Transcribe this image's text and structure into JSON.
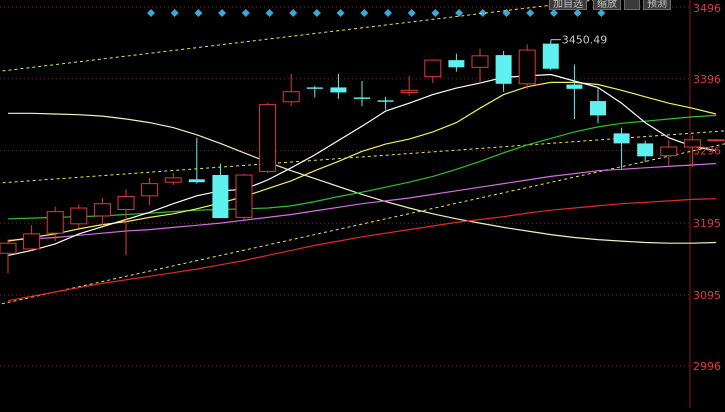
{
  "toolbar": {
    "add_self_select": "加自选",
    "shrink": "缩放",
    "square_icon": "square-icon",
    "preview": "预测"
  },
  "colors": {
    "background": "#000000",
    "up_candle": "#e23a3a",
    "down_candle": "#5ff0f0",
    "ma_white": "#ffffff",
    "ma_yellow": "#f0f060",
    "ma_green": "#30c030",
    "ma_purple": "#d070e0",
    "ma_red": "#e02a2a",
    "ma_long": "#f0f0c0",
    "trend": "#e8e850",
    "grid": "#8a1a1a",
    "marker": "#3aa8d8"
  },
  "chart_data": {
    "type": "candlestick",
    "y_axis_ticks": [
      "3496",
      "3396",
      "3296",
      "3195",
      "3095",
      "2996"
    ],
    "y_tick_values": [
      3496,
      3396,
      3296,
      3195,
      3095,
      2996
    ],
    "ylim": [
      2980,
      3500
    ],
    "high_annotation": "3450.49",
    "high_value": 3450.49,
    "marker_count": 20,
    "candles": [
      {
        "o": 3153,
        "h": 3172,
        "l": 3125,
        "c": 3167
      },
      {
        "o": 3159,
        "h": 3192,
        "l": 3157,
        "c": 3180
      },
      {
        "o": 3181,
        "h": 3218,
        "l": 3170,
        "c": 3211
      },
      {
        "o": 3194,
        "h": 3221,
        "l": 3188,
        "c": 3216
      },
      {
        "o": 3205,
        "h": 3230,
        "l": 3192,
        "c": 3222
      },
      {
        "o": 3214,
        "h": 3242,
        "l": 3150,
        "c": 3232
      },
      {
        "o": 3233,
        "h": 3258,
        "l": 3220,
        "c": 3250
      },
      {
        "o": 3252,
        "h": 3265,
        "l": 3248,
        "c": 3258
      },
      {
        "o": 3256,
        "h": 3314,
        "l": 3250,
        "c": 3252
      },
      {
        "o": 3262,
        "h": 3278,
        "l": 3205,
        "c": 3202
      },
      {
        "o": 3203,
        "h": 3264,
        "l": 3200,
        "c": 3262
      },
      {
        "o": 3267,
        "h": 3362,
        "l": 3265,
        "c": 3360
      },
      {
        "o": 3364,
        "h": 3403,
        "l": 3358,
        "c": 3378
      },
      {
        "o": 3384,
        "h": 3386,
        "l": 3370,
        "c": 3382
      },
      {
        "o": 3384,
        "h": 3403,
        "l": 3368,
        "c": 3377
      },
      {
        "o": 3370,
        "h": 3393,
        "l": 3358,
        "c": 3368
      },
      {
        "o": 3366,
        "h": 3371,
        "l": 3353,
        "c": 3364
      },
      {
        "o": 3377,
        "h": 3400,
        "l": 3372,
        "c": 3380
      },
      {
        "o": 3399,
        "h": 3423,
        "l": 3390,
        "c": 3422
      },
      {
        "o": 3422,
        "h": 3431,
        "l": 3406,
        "c": 3412
      },
      {
        "o": 3412,
        "h": 3438,
        "l": 3390,
        "c": 3428
      },
      {
        "o": 3429,
        "h": 3435,
        "l": 3378,
        "c": 3389
      },
      {
        "o": 3389,
        "h": 3444,
        "l": 3382,
        "c": 3436
      },
      {
        "o": 3445,
        "h": 3450.49,
        "l": 3408,
        "c": 3410
      },
      {
        "o": 3388,
        "h": 3416,
        "l": 3340,
        "c": 3382
      },
      {
        "o": 3365,
        "h": 3384,
        "l": 3334,
        "c": 3345
      },
      {
        "o": 3320,
        "h": 3328,
        "l": 3271,
        "c": 3306
      },
      {
        "o": 3306,
        "h": 3310,
        "l": 3280,
        "c": 3288
      },
      {
        "o": 3289,
        "h": 3311,
        "l": 3274,
        "c": 3301
      },
      {
        "o": 3301,
        "h": 3317,
        "l": 3273,
        "c": 3311
      },
      {
        "o": 3311,
        "h": 3312,
        "l": 3310,
        "c": 3311
      }
    ],
    "ma_white": [
      3150,
      3157,
      3166,
      3180,
      3190,
      3200,
      3210,
      3222,
      3233,
      3240,
      3242,
      3255,
      3272,
      3290,
      3310,
      3330,
      3351,
      3362,
      3374,
      3383,
      3390,
      3398,
      3400,
      3402,
      3393,
      3384,
      3362,
      3335,
      3314,
      3302,
      3296
    ],
    "ma_yellow": [
      3170,
      3175,
      3180,
      3187,
      3193,
      3197,
      3203,
      3208,
      3215,
      3223,
      3232,
      3243,
      3254,
      3268,
      3281,
      3295,
      3305,
      3312,
      3322,
      3335,
      3355,
      3374,
      3385,
      3391,
      3391,
      3388,
      3380,
      3371,
      3362,
      3355,
      3347
    ],
    "ma_green": [
      3201,
      3202,
      3203,
      3204,
      3205,
      3207,
      3209,
      3211,
      3213,
      3214,
      3215,
      3216,
      3219,
      3225,
      3232,
      3238,
      3245,
      3252,
      3260,
      3270,
      3281,
      3293,
      3304,
      3313,
      3322,
      3329,
      3334,
      3337,
      3340,
      3343,
      3345
    ],
    "ma_purple": [
      3171,
      3173,
      3175,
      3178,
      3181,
      3184,
      3186,
      3189,
      3192,
      3195,
      3199,
      3203,
      3207,
      3212,
      3217,
      3222,
      3226,
      3230,
      3235,
      3240,
      3245,
      3250,
      3255,
      3260,
      3264,
      3268,
      3270,
      3272,
      3274,
      3276,
      3278
    ],
    "ma_red": [
      3087,
      3093,
      3099,
      3105,
      3111,
      3116,
      3121,
      3126,
      3131,
      3137,
      3143,
      3150,
      3157,
      3164,
      3170,
      3176,
      3181,
      3186,
      3191,
      3196,
      3200,
      3204,
      3209,
      3213,
      3216,
      3219,
      3222,
      3224,
      3226,
      3228,
      3229
    ],
    "ma_long": [
      3348,
      3348,
      3347,
      3346,
      3344,
      3340,
      3335,
      3328,
      3318,
      3306,
      3293,
      3280,
      3268,
      3257,
      3246,
      3235,
      3225,
      3216,
      3208,
      3201,
      3195,
      3189,
      3184,
      3179,
      3175,
      3172,
      3170,
      3168,
      3167,
      3167,
      3168
    ],
    "trend_lines": [
      {
        "x0": -2,
        "y0": 3400,
        "x1": 31,
        "y1": 3530
      },
      {
        "x0": -2,
        "y0": 3247,
        "x1": 31,
        "y1": 3325
      },
      {
        "x0": -2,
        "y0": 3070,
        "x1": 31,
        "y1": 3310
      }
    ]
  }
}
